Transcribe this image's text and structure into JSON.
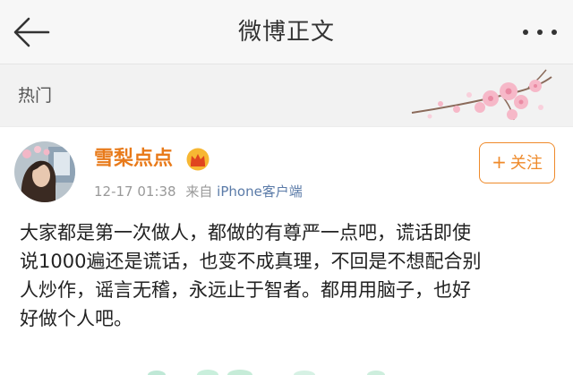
{
  "header": {
    "title": "微博正文",
    "back_icon": "arrow-left-icon",
    "more_icon": "more-dots-icon"
  },
  "hot_bar": {
    "label": "热门",
    "decoration_icon": "cherry-blossom-icon"
  },
  "post": {
    "author": {
      "name": "雪梨点点",
      "badge_icon": "crown-icon",
      "avatar_icon": "avatar-photo"
    },
    "timestamp": "12-17 01:38",
    "source_prefix": "来自",
    "source_client": "iPhone客户端",
    "follow_plus": "+",
    "follow_label": "关注",
    "text_lines": [
      "大家都是第一次做人，都做的有尊严一点吧，谎话即使",
      "说1000遍还是谎话，也变不成真理，不回是不想配合别",
      "人炒作，谣言无稽，永远止于智者。都用用脑子，也好",
      "好做个人吧。"
    ]
  },
  "colors": {
    "accent": "#ef8a2a",
    "username": "#e87a1a",
    "link": "#5b7ba8",
    "muted": "#999999",
    "header_bg": "#f7f7f7",
    "hot_bg": "#f2f2f2"
  }
}
